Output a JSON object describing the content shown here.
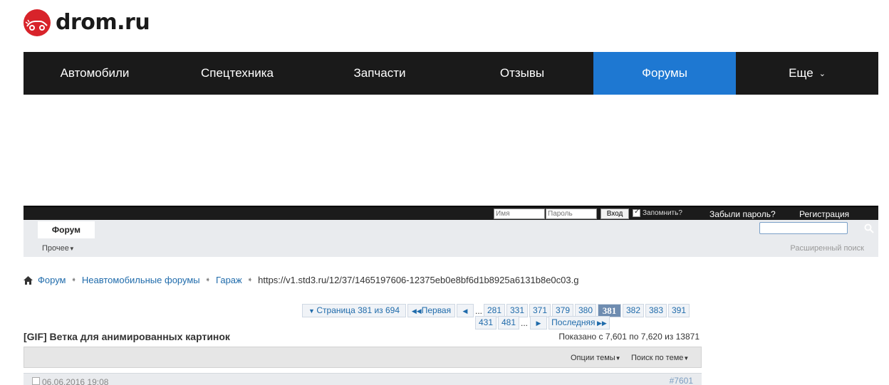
{
  "brand": {
    "name": "drom.ru",
    "color": "#d8232a"
  },
  "main_nav": {
    "items": [
      {
        "label": "Автомобили"
      },
      {
        "label": "Спецтехника"
      },
      {
        "label": "Запчасти"
      },
      {
        "label": "Отзывы"
      },
      {
        "label": "Форумы"
      },
      {
        "label": "Еще"
      }
    ],
    "active": "Форумы",
    "active_color": "#1e78d2"
  },
  "login": {
    "username_placeholder": "Имя",
    "password_placeholder": "Пароль",
    "login_button": "Вход",
    "remember_label": "Запомнить?",
    "forgot_password": "Забыли пароль?",
    "register": "Регистрация"
  },
  "forum_nav": {
    "tab": "Форум",
    "misc": "Прочее",
    "advanced_search": "Расширенный поиск"
  },
  "breadcrumb": {
    "items": [
      "Форум",
      "Неавтомобильные форумы",
      "Гараж"
    ],
    "current": "https://v1.std3.ru/12/37/1465197606-12375eb0e8bf6d1b8925a6131b8e0c03.g"
  },
  "pagination": {
    "page_info": "Страница 381 из 694",
    "first": "Первая",
    "last": "Последняя",
    "dots": "...",
    "row1": [
      "281",
      "331",
      "371",
      "379",
      "380",
      "381",
      "382",
      "383",
      "391"
    ],
    "row2": [
      "431",
      "481"
    ],
    "current": "381"
  },
  "thread": {
    "title": "[GIF] Ветка для анимированных картинок",
    "shown": "Показано с 7,601 по 7,620 из 13871",
    "options": "Опции темы",
    "search": "Поиск по теме"
  },
  "post": {
    "date": "06.06.2016 19:08",
    "number": "#7601"
  }
}
